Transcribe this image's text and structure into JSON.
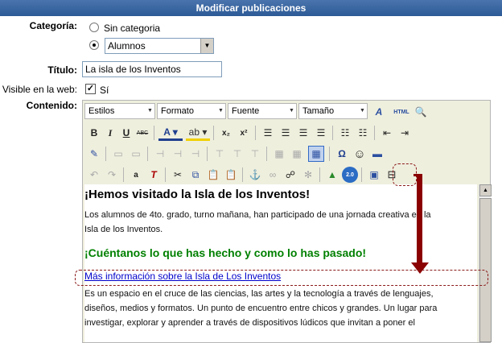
{
  "window": {
    "title": "Modificar publicaciones"
  },
  "form": {
    "category_label": "Categoría:",
    "no_category_label": "Sin categoria",
    "category_selected": "Alumnos",
    "title_label": "Título:",
    "title_value": "La isla de los Inventos",
    "visible_label": "Visible en la web:",
    "visible_check_label": "Sí",
    "content_label": "Contenido:"
  },
  "editor": {
    "combos": {
      "styles": "Estilos",
      "format": "Formato",
      "font": "Fuente",
      "size": "Tamaño"
    },
    "buttons": {
      "html": "HTML",
      "bold": "B",
      "italic": "I",
      "underline": "U",
      "strike": "ABC",
      "omega": "Ω",
      "badge": "2.0"
    },
    "content": {
      "heading": "¡Hemos visitado la Isla de los Inventos!",
      "para1_line1": "Los alumnos de 4to. grado, turno mañana, han participado de una jornada creativa en la",
      "para1_line2": "Isla de los Inventos.",
      "green_heading": "¡Cuéntanos lo que has hecho y como lo has pasado!",
      "link": "Más información sobre la Isla de Los Inventos",
      "para2_line1": "Es un espacio en el cruce de las ciencias, las artes y la tecnología a través de lenguajes,",
      "para2_line2": "diseños, medios y formatos. Un punto de encuentro entre chicos y grandes. Un lugar para",
      "para2_line3": "investigar, explorar y aprender a través de dispositivos lúdicos que invitan a poner el"
    }
  },
  "colors": {
    "titlebar": "#2c5a96",
    "toolbar_bg": "#efefde",
    "green_heading": "#008000",
    "annotation": "#8b0000"
  }
}
